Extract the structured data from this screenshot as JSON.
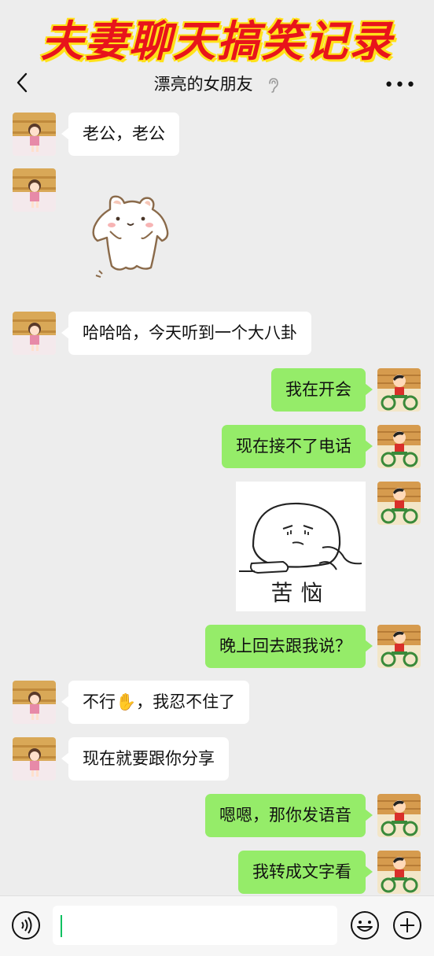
{
  "banner": {
    "text": "夫妻聊天搞笑记录"
  },
  "header": {
    "title": "漂亮的女朋友"
  },
  "messages": [
    {
      "side": "left",
      "type": "text",
      "text": "老公，老公"
    },
    {
      "side": "left",
      "type": "sticker",
      "sticker": "hamster-sticker"
    },
    {
      "side": "left",
      "type": "text",
      "text": "哈哈哈，今天听到一个大八卦"
    },
    {
      "side": "right",
      "type": "text",
      "text": "我在开会"
    },
    {
      "side": "right",
      "type": "text",
      "text": "现在接不了电话"
    },
    {
      "side": "right",
      "type": "sticker",
      "sticker": "troubled-sticker",
      "caption": "苦恼"
    },
    {
      "side": "right",
      "type": "text",
      "text": "晚上回去跟我说？"
    },
    {
      "side": "left",
      "type": "text",
      "text_before": "不行",
      "emoji": "✋",
      "text_after": "，我忍不住了"
    },
    {
      "side": "left",
      "type": "text",
      "text": "现在就要跟你分享"
    },
    {
      "side": "right",
      "type": "text",
      "text": "嗯嗯，那你发语音"
    },
    {
      "side": "right",
      "type": "text",
      "text": "我转成文字看"
    }
  ],
  "icons": {
    "back": "back-arrow-icon",
    "mute": "ear-icon",
    "more": "more-icon",
    "voice": "voice-icon",
    "emoji": "emoji-icon",
    "plus": "plus-icon"
  },
  "colors": {
    "bubble_right": "#95ec69",
    "bubble_left": "#ffffff",
    "background": "#ededed",
    "banner_text": "#e8141b",
    "banner_outline": "#ffe21a"
  }
}
